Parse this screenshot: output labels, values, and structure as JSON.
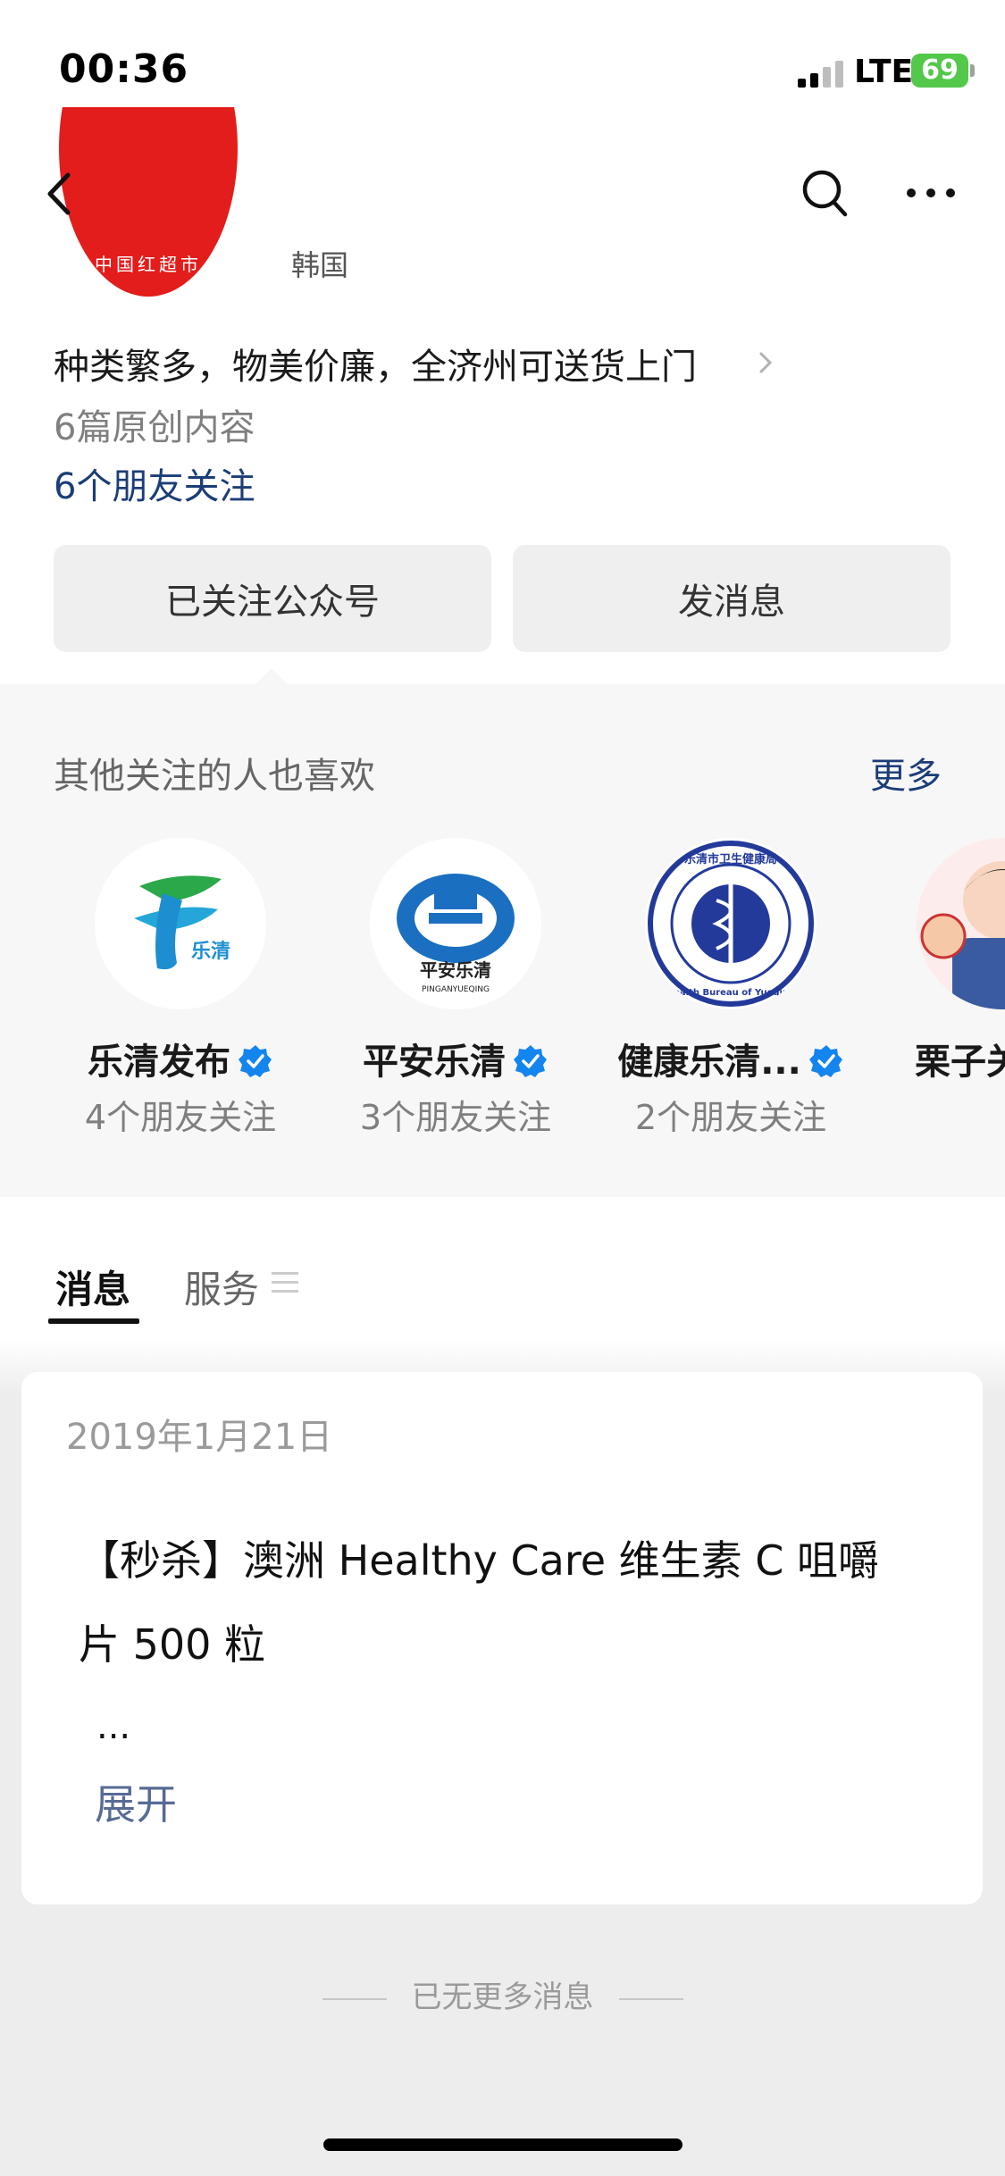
{
  "status_bar": {
    "time": "00:36",
    "network": "LTE",
    "battery": "69"
  },
  "nav": {
    "back_icon": "chevron-left-icon",
    "search_icon": "search-icon",
    "more_icon": "more-dots-icon"
  },
  "account": {
    "avatar_text": "中国红超市",
    "name_fragment": "韩国",
    "description": "种类繁多，物美价廉，全济州可送货上门",
    "original_count": "6篇原创内容",
    "friends_following": "6个朋友关注"
  },
  "actions": {
    "follow_label": "已关注公众号",
    "message_label": "发消息"
  },
  "recommendations": {
    "title": "其他关注的人也喜欢",
    "more_label": "更多",
    "items": [
      {
        "name": "乐清发布",
        "count": "4个朋友关注",
        "logo_text": "乐清"
      },
      {
        "name": "平安乐清",
        "count": "3个朋友关注",
        "logo_text": "平安乐清",
        "logo_subtext": "PINGANYUEQING"
      },
      {
        "name": "健康乐清...",
        "count": "2个朋友关注",
        "logo_text": "乐清市卫生健康局",
        "logo_subtext": "Health Bureau of Yueqing"
      },
      {
        "name": "栗子关",
        "count": ""
      }
    ]
  },
  "tabs": {
    "messages": "消息",
    "services": "服务"
  },
  "message_card": {
    "date": "2019年1月21日",
    "title": "【秒杀】澳洲 Healthy Care 维生素 C 咀嚼片 500 粒",
    "ellipsis": "...",
    "expand_label": "展开"
  },
  "footer": {
    "no_more": "已无更多消息"
  },
  "colors": {
    "link_blue": "#1b3d78",
    "expand_blue": "#576b95",
    "verified_blue": "#1485ee",
    "battery_green": "#53c84a"
  }
}
